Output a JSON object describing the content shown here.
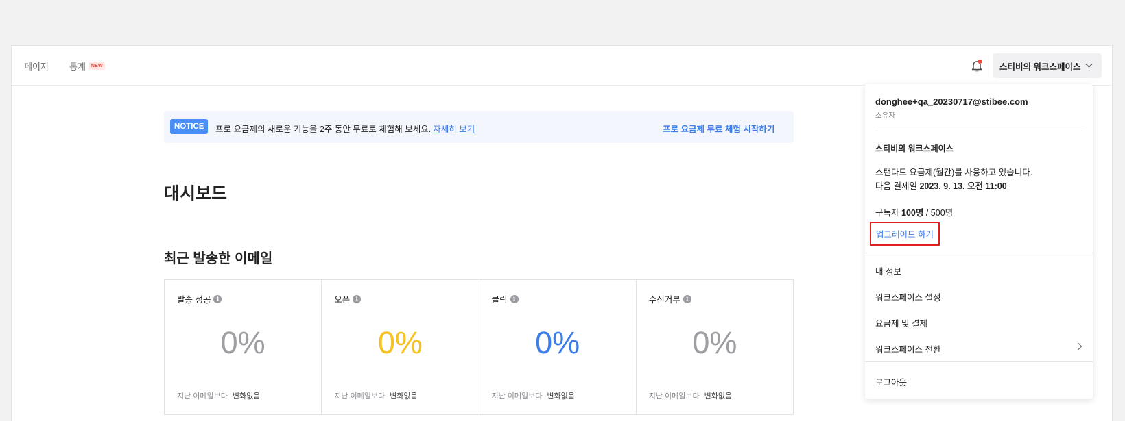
{
  "topbar": {
    "nav_pages": "페이지",
    "nav_stats": "통계",
    "nav_stats_badge": "NEW",
    "workspace_button": "스티비의 워크스페이스"
  },
  "notice": {
    "badge": "NOTICE",
    "text": "프로 요금제의 새로운 기능을 2주 동안 무료로 체험해 보세요.",
    "link": "자세히 보기",
    "cta": "프로 요금제 무료 체험 시작하기"
  },
  "main": {
    "title": "대시보드",
    "section_title": "최근 발송한 이메일",
    "stats": [
      {
        "label": "발송 성공",
        "value": "0%",
        "color": "#9e9ea4",
        "foot_label": "지난 이메일보다",
        "foot_value": "변화없음"
      },
      {
        "label": "오픈",
        "value": "0%",
        "color": "#f7c120",
        "foot_label": "지난 이메일보다",
        "foot_value": "변화없음"
      },
      {
        "label": "클릭",
        "value": "0%",
        "color": "#3b7de9",
        "foot_label": "지난 이메일보다",
        "foot_value": "변화없음"
      },
      {
        "label": "수신거부",
        "value": "0%",
        "color": "#9e9ea4",
        "foot_label": "지난 이메일보다",
        "foot_value": "변화없음"
      }
    ]
  },
  "dropdown": {
    "email": "donghee+qa_20230717@stibee.com",
    "role": "소유자",
    "workspace_name": "스티비의 워크스페이스",
    "plan_prefix": "스탠다드 요금제(월간)",
    "plan_suffix": "를 사용하고 있습니다.",
    "next_payment_label": "다음 결제일",
    "next_payment_date": "2023. 9. 13. 오전 11:00",
    "subscribers_label": "구독자",
    "subscribers_count": "100명",
    "subscribers_limit": "/ 500명",
    "upgrade": "업그레이드 하기",
    "menu": [
      "내 정보",
      "워크스페이스 설정",
      "요금제 및 결제",
      "워크스페이스 전환"
    ],
    "logout": "로그아웃"
  },
  "colors": {
    "accent": "#3b7de9",
    "notice_badge": "#4a8df6",
    "highlight_box": "#e0201f",
    "bell_dot": "#e8483c"
  }
}
